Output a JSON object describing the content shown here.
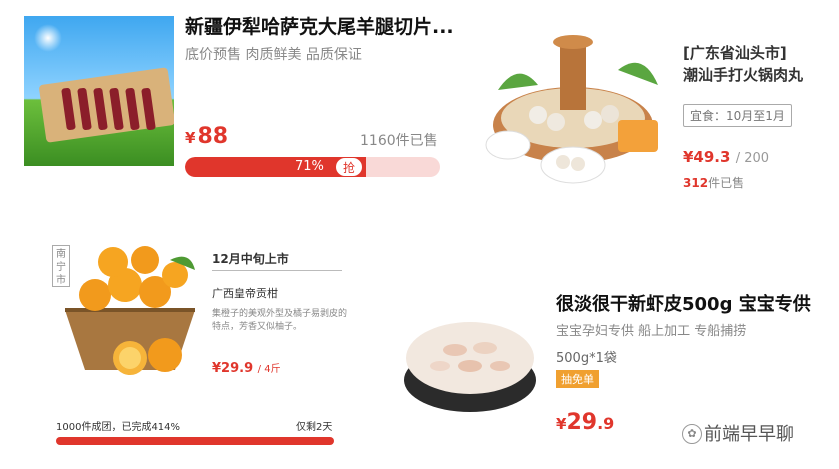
{
  "card1": {
    "title": "新疆伊犁哈萨克大尾羊腿切片...",
    "subtitle": "底价预售 肉质鲜美 品质保证",
    "currency": "¥",
    "price": "88",
    "sold": "1160件已售",
    "progress_label": "71%",
    "progress": 0.71
  },
  "card2": {
    "title_line1": "[广东省汕头市]",
    "title_line2": "潮汕手打火锅肉丸",
    "tag": "宜食：10月至1月",
    "price": "¥49.3",
    "orig_price": "/ 200",
    "sold_count": "312",
    "sold_suffix": "件已售"
  },
  "card3": {
    "stamp": "南宁市",
    "date": "12月中旬上市",
    "name": "广西皇帝贡柑",
    "desc": "集橙子的美观外型及橘子易剥皮的特点，芳香又似柚子。",
    "price": "¥29.9",
    "unit": "/ 4斤",
    "status": "1000件成团，已完成414%",
    "remaining": "仅剩2天"
  },
  "card4": {
    "title": "很淡很干新虾皮500g 宝宝专供",
    "subtitle": "宝宝孕妇专供 船上加工 专船捕捞",
    "spec": "500g*1袋",
    "badge": "抽免单",
    "currency": "¥",
    "price_int": "29",
    "price_dec": ".9"
  },
  "watermark": {
    "text": "前端早早聊"
  },
  "colors": {
    "accent": "#e0362c",
    "badge": "#f0a030"
  }
}
